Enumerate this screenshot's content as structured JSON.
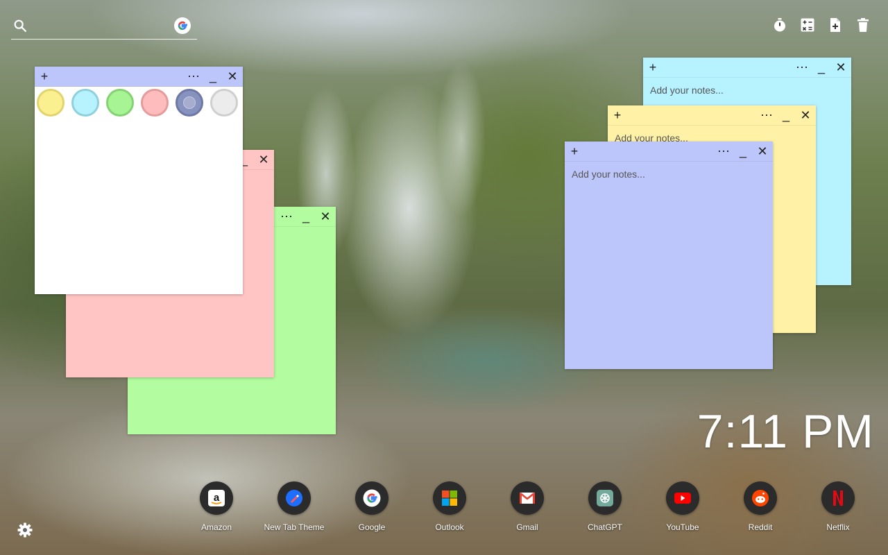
{
  "search": {
    "placeholder": ""
  },
  "toolbar": {
    "timer_icon": "timer-icon",
    "calculator_icon": "calculator-icon",
    "new_note_icon": "note-add-icon",
    "delete_icon": "trash-icon"
  },
  "notes": {
    "white_note": {
      "color": "#ffffff"
    },
    "pink_note": {
      "color": "#ffc5c5"
    },
    "green_note": {
      "color": "#b3fda0"
    },
    "cyan_note": {
      "color": "#b6f2ff",
      "placeholder": "Add your notes..."
    },
    "yellow_note": {
      "color": "#fff2a6",
      "placeholder": "Add your notes..."
    },
    "blue_note": {
      "color": "#bdc6fa",
      "placeholder": "Add your notes..."
    }
  },
  "palette": [
    {
      "name": "yellow",
      "fill": "#fbf08f",
      "ring": "#e2d36d"
    },
    {
      "name": "cyan",
      "fill": "#b6f2ff",
      "ring": "#8fd0dc"
    },
    {
      "name": "green",
      "fill": "#a6f494",
      "ring": "#84d271"
    },
    {
      "name": "pink",
      "fill": "#ffbcbc",
      "ring": "#e59b9b"
    },
    {
      "name": "blue",
      "fill": "#8892bf",
      "ring": "#6e78a6"
    },
    {
      "name": "gray",
      "fill": "#ececec",
      "ring": "#cfcfcf"
    }
  ],
  "clock": {
    "time": "7:11 PM"
  },
  "dock": [
    {
      "label": "Amazon",
      "icon": "amazon-icon"
    },
    {
      "label": "New Tab Theme",
      "icon": "new-tab-theme-icon"
    },
    {
      "label": "Google",
      "icon": "google-icon"
    },
    {
      "label": "Outlook",
      "icon": "outlook-icon"
    },
    {
      "label": "Gmail",
      "icon": "gmail-icon"
    },
    {
      "label": "ChatGPT",
      "icon": "chatgpt-icon"
    },
    {
      "label": "YouTube",
      "icon": "youtube-icon"
    },
    {
      "label": "Reddit",
      "icon": "reddit-icon"
    },
    {
      "label": "Netflix",
      "icon": "netflix-icon"
    }
  ],
  "settings": {
    "icon": "gear-icon"
  }
}
